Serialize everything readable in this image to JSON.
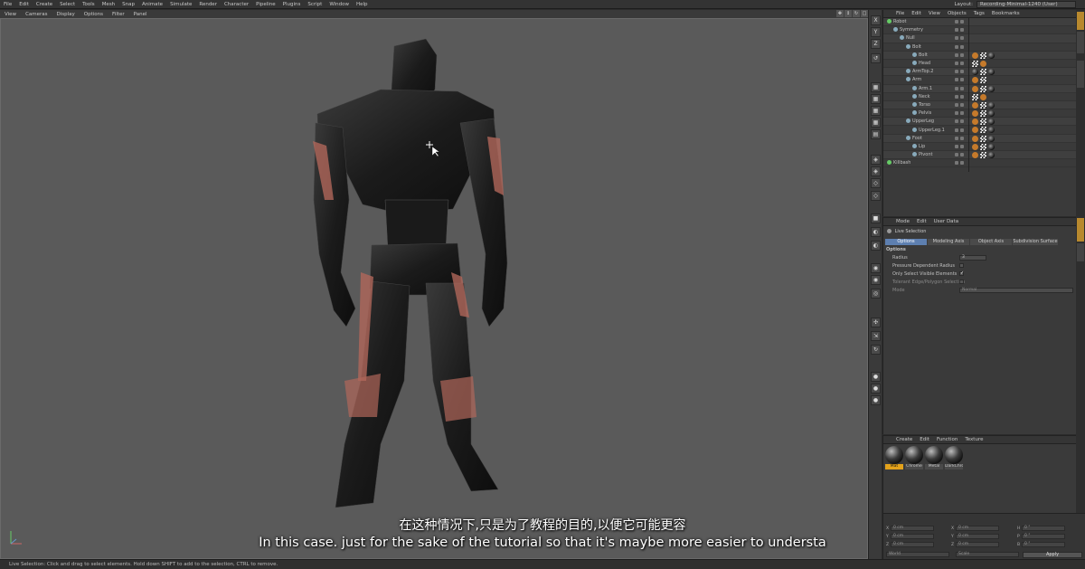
{
  "menu": [
    "File",
    "Edit",
    "Create",
    "Select",
    "Tools",
    "Mesh",
    "Snap",
    "Animate",
    "Simulate",
    "Render",
    "Character",
    "Pipeline",
    "Plugins",
    "Script",
    "Window",
    "Help"
  ],
  "layout": {
    "label": "Layout:",
    "value": "Recording-Minimal-1240 (User)"
  },
  "viewport_menu": [
    "View",
    "Cameras",
    "Display",
    "Options",
    "Filter",
    "Panel"
  ],
  "object_manager": {
    "menu": [
      "File",
      "Edit",
      "View",
      "Objects",
      "Tags",
      "Bookmarks"
    ],
    "objects": [
      {
        "name": "Robot",
        "indent": 0
      },
      {
        "name": "Symmetry",
        "indent": 1
      },
      {
        "name": "Null",
        "indent": 2
      },
      {
        "name": "Bolt",
        "indent": 3
      },
      {
        "name": "Bolt",
        "indent": 4
      },
      {
        "name": "Head",
        "indent": 4
      },
      {
        "name": "ArmTop.2",
        "indent": 3
      },
      {
        "name": "Arm",
        "indent": 3
      },
      {
        "name": "Arm.1",
        "indent": 4
      },
      {
        "name": "Neck",
        "indent": 4
      },
      {
        "name": "Torso",
        "indent": 4
      },
      {
        "name": "Pelvis",
        "indent": 4
      },
      {
        "name": "UpperLeg",
        "indent": 3
      },
      {
        "name": "UpperLeg.1",
        "indent": 4
      },
      {
        "name": "Foot",
        "indent": 3
      },
      {
        "name": "Lip",
        "indent": 4
      },
      {
        "name": "Pivont",
        "indent": 4
      },
      {
        "name": "Killbash",
        "indent": 0
      }
    ]
  },
  "attributes": {
    "menu": [
      "Mode",
      "Edit",
      "User Data"
    ],
    "title": "Live Selection",
    "tabs": [
      "Options",
      "Modeling Axis",
      "Object Axis",
      "Subdivision Surface"
    ],
    "section": "Options",
    "radius_label": "Radius",
    "radius_value": "3",
    "pressure_label": "Pressure Dependent Radius",
    "visible_label": "Only Select Visible Elements",
    "visible_check": "✓",
    "tolerant_label": "Tolerant Edge/Polygon Selection",
    "mode_label": "Mode",
    "mode_value": "Normal"
  },
  "materials": {
    "menu": [
      "Create",
      "Edit",
      "Function",
      "Texture"
    ],
    "items": [
      "Mat",
      "Chrome",
      "Metal",
      "DarkChro"
    ]
  },
  "coordinates": {
    "rows": [
      {
        "a": "X",
        "av": "0 cm",
        "b": "X",
        "bv": "0 cm",
        "c": "H",
        "cv": "0 °"
      },
      {
        "a": "Y",
        "av": "0 cm",
        "b": "Y",
        "bv": "0 cm",
        "c": "P",
        "cv": "0 °"
      },
      {
        "a": "Z",
        "av": "0 cm",
        "b": "Z",
        "bv": "0 cm",
        "c": "B",
        "cv": "0 °"
      }
    ],
    "world": "World",
    "scale": "Scale",
    "apply": "Apply"
  },
  "tools": [
    "X",
    "Y",
    "Z"
  ],
  "status": "Live Selection: Click and drag to select elements. Hold down SHIFT to add to the selection, CTRL to remove.",
  "subtitles": {
    "cn": "在这种情况下,只是为了教程的目的,以便它可能更容",
    "en": "In this case. just for the sake of the tutorial so that it's maybe more easier to understa"
  },
  "colors": {
    "accent": "#5d7fb0",
    "selected_material": "#e3a21b",
    "armor_accent": "#b0675a"
  }
}
